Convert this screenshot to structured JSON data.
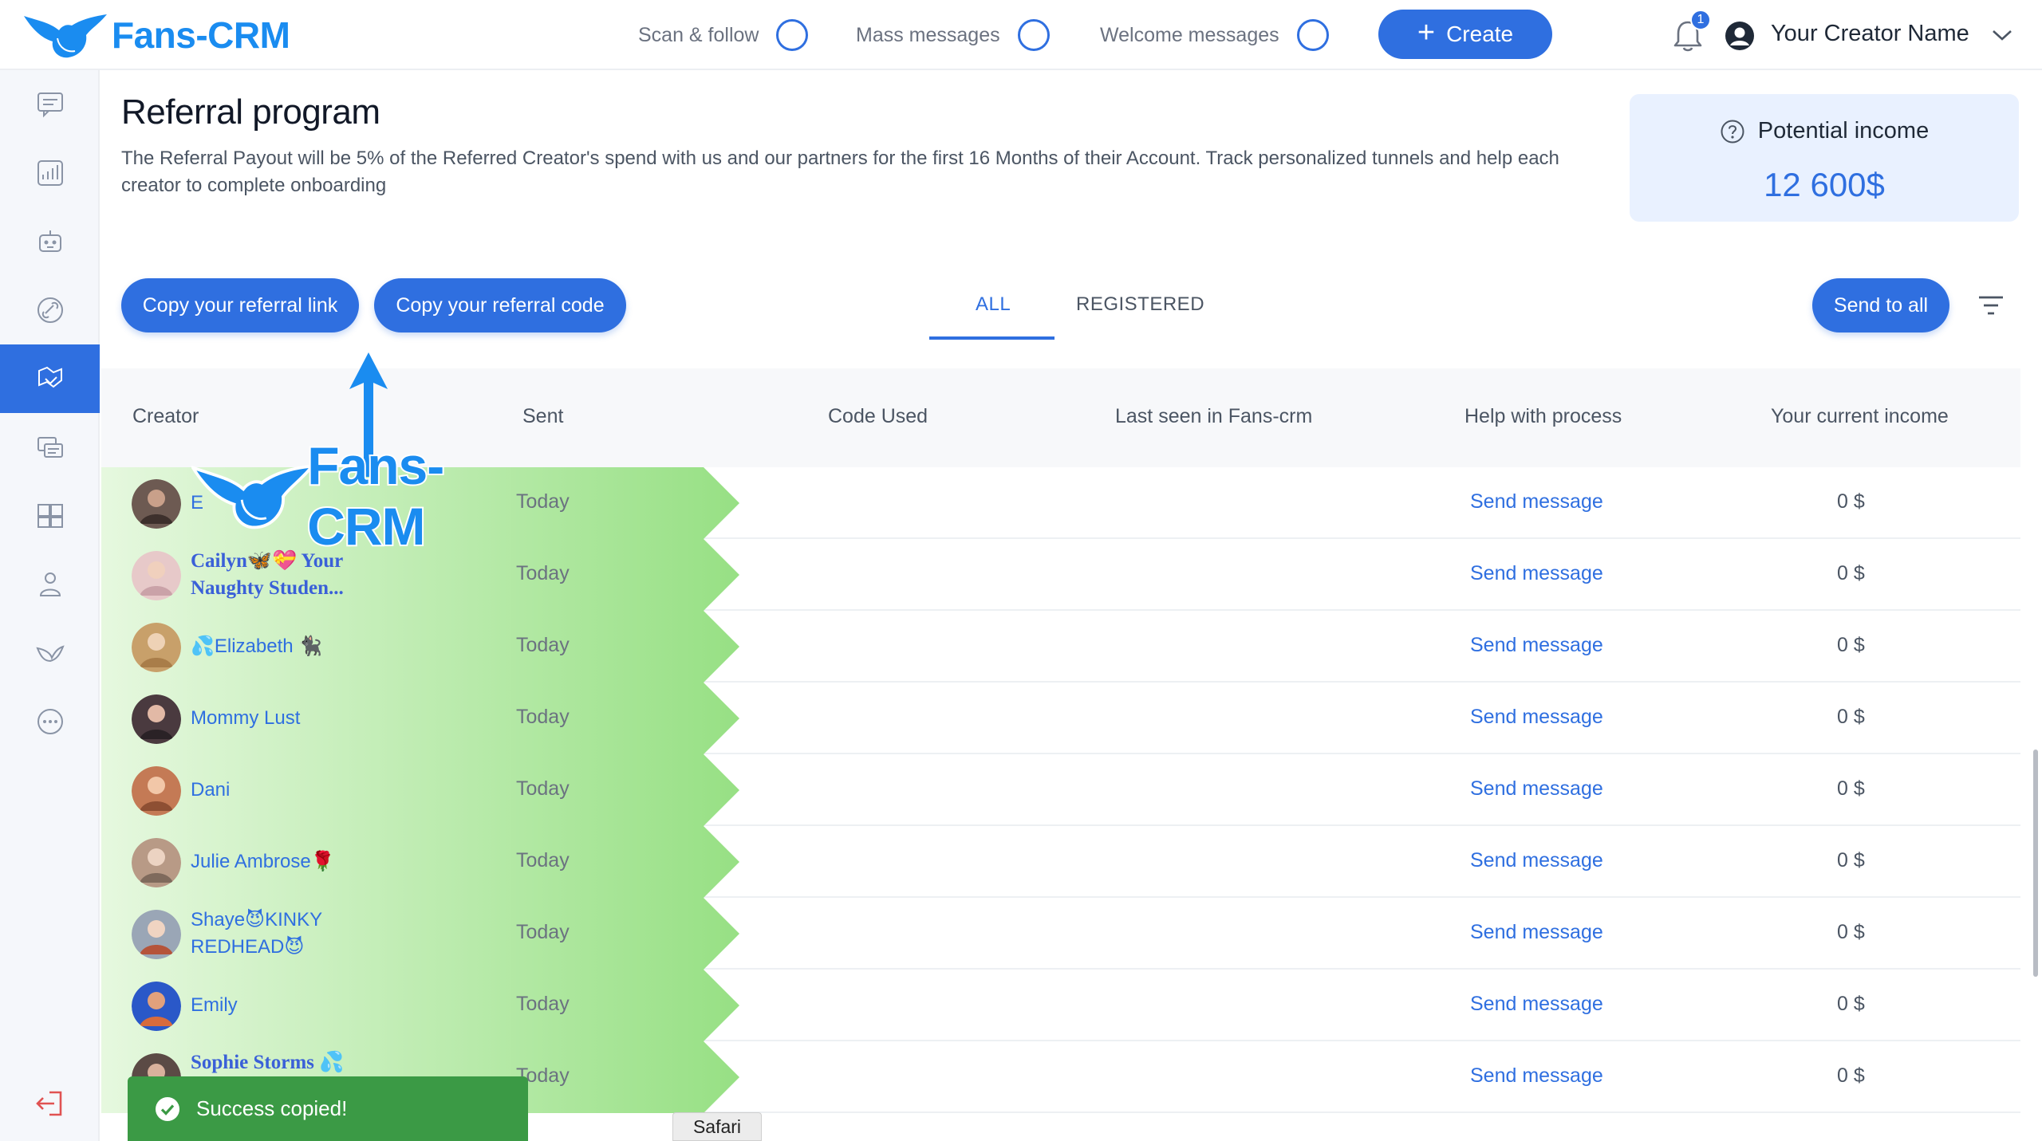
{
  "app": {
    "logo_text": "Fans-CRM"
  },
  "topbar": {
    "scan_follow": "Scan & follow",
    "mass_messages": "Mass messages",
    "welcome_messages": "Welcome messages",
    "create_label": "Create",
    "notification_count": "1",
    "user_name": "Your Creator Name"
  },
  "sidebar": {
    "items": [
      "chat-icon",
      "analytics-icon",
      "bot-icon",
      "tracking-links-icon",
      "referral-icon",
      "messages-icon",
      "vault-icon",
      "team-icon",
      "promo-icon",
      "more-icon"
    ],
    "active_index": 4,
    "logout": "logout-icon"
  },
  "page": {
    "title": "Referral program",
    "description": "The Referral Payout will be 5% of the Referred Creator's spend with us and our partners for the first 16 Months of their Account. Track personalized tunnels and help each creator to complete onboarding"
  },
  "income_card": {
    "label": "Potential income",
    "value": "12 600$"
  },
  "actions": {
    "copy_link": "Copy your referral link",
    "copy_code": "Copy your referral code",
    "send_to_all": "Send to all"
  },
  "tabs": {
    "all": "ALL",
    "registered": "REGISTERED",
    "active": "all"
  },
  "table": {
    "columns": {
      "creator": "Creator",
      "sent": "Sent",
      "code_used": "Code Used",
      "last_seen": "Last seen in Fans-crm",
      "help": "Help with process",
      "income": "Your current income"
    },
    "rows": [
      {
        "name": "E",
        "sent": "Today",
        "action": "Send message",
        "income": "0 $"
      },
      {
        "name": "Cailyn🦋💝 Your Naughty Studen...",
        "sent": "Today",
        "action": "Send message",
        "income": "0 $"
      },
      {
        "name": "💦Elizabeth 🐈‍⬛",
        "sent": "Today",
        "action": "Send message",
        "income": "0 $"
      },
      {
        "name": "Mommy Lust",
        "sent": "Today",
        "action": "Send message",
        "income": "0 $"
      },
      {
        "name": "Dani",
        "sent": "Today",
        "action": "Send message",
        "income": "0 $"
      },
      {
        "name": "Julie Ambrose🌹",
        "sent": "Today",
        "action": "Send message",
        "income": "0 $"
      },
      {
        "name": "Shaye😈KINKY REDHEAD😈",
        "sent": "Today",
        "action": "Send message",
        "income": "0 $"
      },
      {
        "name": "Emily",
        "sent": "Today",
        "action": "Send message",
        "income": "0 $"
      },
      {
        "name": "Sophie Storms 💦",
        "sent": "Today",
        "action": "Send message",
        "income": "0 $"
      }
    ]
  },
  "overlay": {
    "logo_text": "Fans-CRM"
  },
  "toast": {
    "message": "Success copied!"
  },
  "tooltip": {
    "text": "Safari"
  },
  "colors": {
    "accent": "#2f6fe0",
    "brand": "#1a8cf0",
    "success": "#3b9a45",
    "row_highlight": "#9ee28a"
  }
}
